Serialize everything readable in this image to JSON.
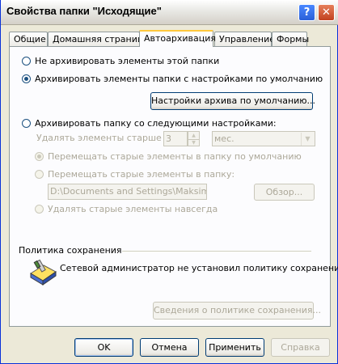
{
  "window": {
    "title": "Свойства папки \"Исходящие\"",
    "help_icon": "?",
    "close_icon": "✕"
  },
  "tabs": [
    "Общие",
    "Домашняя страница",
    "Автоархивация",
    "Управление",
    "Формы"
  ],
  "active_tab": "Автоархивация",
  "options": {
    "no_archive": "Не архивировать элементы этой папки",
    "archive_default": "Архивировать элементы папки с настройками по умолчанию",
    "default_settings_button": "Настройки архива по умолчанию...",
    "archive_custom": "Архивировать папку со следующими настройками:",
    "delete_older_label": "Удалять элементы старше",
    "delete_older_value": "3",
    "period_unit": "мес.",
    "move_default": "Перемещать старые элементы в папку по умолчанию",
    "move_to_folder": "Перемещать старые элементы в папку:",
    "folder_path": "D:\\Documents and Settings\\Maksim\\Loca",
    "browse_button": "Обзор...",
    "delete_forever": "Удалять старые элементы навсегда"
  },
  "retention": {
    "group_title": "Политика сохранения",
    "message": "Сетевой администратор не установил политику сохранения.",
    "info_button": "Сведения о политике сохранения..."
  },
  "footer": {
    "ok": "OK",
    "cancel": "Отмена",
    "apply": "Применить",
    "help": "Справка"
  }
}
